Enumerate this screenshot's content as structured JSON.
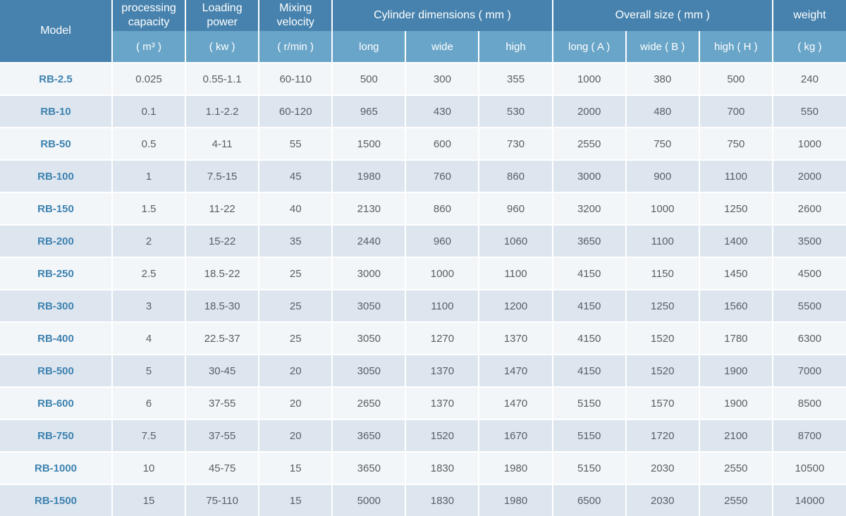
{
  "table": {
    "header": {
      "model": "Model",
      "columns": [
        {
          "label": "processing capacity",
          "unit": "( m³ )"
        },
        {
          "label": "Loading power",
          "unit": "( kw )"
        },
        {
          "label": "Mixing velocity",
          "unit": "( r/min )"
        }
      ],
      "groups": [
        {
          "label": "Cylinder dimensions ( mm )",
          "subs": [
            "long",
            "wide",
            "high"
          ]
        },
        {
          "label": "Overall size ( mm )",
          "subs": [
            "long ( A )",
            "wide ( B )",
            "high ( H )"
          ]
        }
      ],
      "weight": {
        "label": "weight",
        "unit": "( kg )"
      }
    },
    "rows": [
      [
        "RB-2.5",
        "0.025",
        "0.55-1.1",
        "60-110",
        "500",
        "300",
        "355",
        "1000",
        "380",
        "500",
        "240"
      ],
      [
        "RB-10",
        "0.1",
        "1.1-2.2",
        "60-120",
        "965",
        "430",
        "530",
        "2000",
        "480",
        "700",
        "550"
      ],
      [
        "RB-50",
        "0.5",
        "4-11",
        "55",
        "1500",
        "600",
        "730",
        "2550",
        "750",
        "750",
        "1000"
      ],
      [
        "RB-100",
        "1",
        "7.5-15",
        "45",
        "1980",
        "760",
        "860",
        "3000",
        "900",
        "1100",
        "2000"
      ],
      [
        "RB-150",
        "1.5",
        "11-22",
        "40",
        "2130",
        "860",
        "960",
        "3200",
        "1000",
        "1250",
        "2600"
      ],
      [
        "RB-200",
        "2",
        "15-22",
        "35",
        "2440",
        "960",
        "1060",
        "3650",
        "1100",
        "1400",
        "3500"
      ],
      [
        "RB-250",
        "2.5",
        "18.5-22",
        "25",
        "3000",
        "1000",
        "1100",
        "4150",
        "1150",
        "1450",
        "4500"
      ],
      [
        "RB-300",
        "3",
        "18.5-30",
        "25",
        "3050",
        "1100",
        "1200",
        "4150",
        "1250",
        "1560",
        "5500"
      ],
      [
        "RB-400",
        "4",
        "22.5-37",
        "25",
        "3050",
        "1270",
        "1370",
        "4150",
        "1520",
        "1780",
        "6300"
      ],
      [
        "RB-500",
        "5",
        "30-45",
        "20",
        "3050",
        "1370",
        "1470",
        "4150",
        "1520",
        "1900",
        "7000"
      ],
      [
        "RB-600",
        "6",
        "37-55",
        "20",
        "2650",
        "1370",
        "1470",
        "5150",
        "1570",
        "1900",
        "8500"
      ],
      [
        "RB-750",
        "7.5",
        "37-55",
        "20",
        "3650",
        "1520",
        "1670",
        "5150",
        "1720",
        "2100",
        "8700"
      ],
      [
        "RB-1000",
        "10",
        "45-75",
        "15",
        "3650",
        "1830",
        "1980",
        "5150",
        "2030",
        "2550",
        "10500"
      ],
      [
        "RB-1500",
        "15",
        "75-110",
        "15",
        "5000",
        "1830",
        "1980",
        "6500",
        "2030",
        "2550",
        "14000"
      ]
    ]
  },
  "colors": {
    "header_dark": "#4682ad",
    "header_light": "#69a5c8",
    "row_odd": "#f2f6f9",
    "row_even": "#dde6ef",
    "model_text": "#3e82b0",
    "cell_text": "#595e63"
  }
}
